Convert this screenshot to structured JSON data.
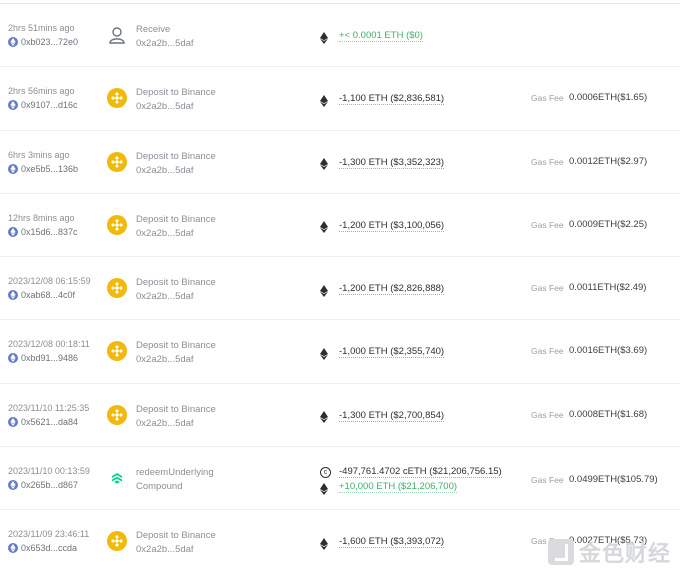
{
  "colors": {
    "bnb": "#f0b90b",
    "eth_badge": "#6478cc",
    "positive": "#3fae6c",
    "compound": "#00d395"
  },
  "gas_label": "Gas Fee",
  "watermark": "金色财经",
  "transactions": [
    {
      "time": "2hrs 51mins ago",
      "hash": "0xb023...72e0",
      "action": "Receive",
      "action_icon": "user-icon",
      "address": "0x2a2b...5daf",
      "amounts": [
        {
          "icon": "eth-icon",
          "text": "+< 0.0001 ETH ($0)",
          "positive": true
        }
      ],
      "gas": ""
    },
    {
      "time": "2hrs 56mins ago",
      "hash": "0x9107...d16c",
      "action": "Deposit to Binance",
      "action_icon": "binance-icon",
      "address": "0x2a2b...5daf",
      "amounts": [
        {
          "icon": "eth-icon",
          "text": "-1,100 ETH ($2,836,581)",
          "positive": false
        }
      ],
      "gas": "0.0006ETH($1.65)"
    },
    {
      "time": "6hrs 3mins ago",
      "hash": "0xe5b5...136b",
      "action": "Deposit to Binance",
      "action_icon": "binance-icon",
      "address": "0x2a2b...5daf",
      "amounts": [
        {
          "icon": "eth-icon",
          "text": "-1,300 ETH ($3,352,323)",
          "positive": false
        }
      ],
      "gas": "0.0012ETH($2.97)"
    },
    {
      "time": "12hrs 8mins ago",
      "hash": "0x15d6...837c",
      "action": "Deposit to Binance",
      "action_icon": "binance-icon",
      "address": "0x2a2b...5daf",
      "amounts": [
        {
          "icon": "eth-icon",
          "text": "-1,200 ETH ($3,100,056)",
          "positive": false
        }
      ],
      "gas": "0.0009ETH($2.25)"
    },
    {
      "time": "2023/12/08 06:15:59",
      "hash": "0xab68...4c0f",
      "action": "Deposit to Binance",
      "action_icon": "binance-icon",
      "address": "0x2a2b...5daf",
      "amounts": [
        {
          "icon": "eth-icon",
          "text": "-1,200 ETH ($2,826,888)",
          "positive": false
        }
      ],
      "gas": "0.0011ETH($2.49)"
    },
    {
      "time": "2023/12/08 00:18:11",
      "hash": "0xbd91...9486",
      "action": "Deposit to Binance",
      "action_icon": "binance-icon",
      "address": "0x2a2b...5daf",
      "amounts": [
        {
          "icon": "eth-icon",
          "text": "-1,000 ETH ($2,355,740)",
          "positive": false
        }
      ],
      "gas": "0.0016ETH($3.69)"
    },
    {
      "time": "2023/11/10 11:25:35",
      "hash": "0x5621...da84",
      "action": "Deposit to Binance",
      "action_icon": "binance-icon",
      "address": "0x2a2b...5daf",
      "amounts": [
        {
          "icon": "eth-icon",
          "text": "-1,300 ETH ($2,700,854)",
          "positive": false
        }
      ],
      "gas": "0.0008ETH($1.68)"
    },
    {
      "time": "2023/11/10 00:13:59",
      "hash": "0x265b...d867",
      "action": "redeemUnderlying",
      "action_icon": "compound-icon",
      "address": "Compound",
      "amounts": [
        {
          "icon": "ceth-icon",
          "text": "-497,761.4702 cETH ($21,206,756.15)",
          "positive": false
        },
        {
          "icon": "eth-icon",
          "text": "+10,000 ETH ($21,206,700)",
          "positive": true
        }
      ],
      "gas": "0.0499ETH($105.79)"
    },
    {
      "time": "2023/11/09 23:46:11",
      "hash": "0x653d...ccda",
      "action": "Deposit to Binance",
      "action_icon": "binance-icon",
      "address": "0x2a2b...5daf",
      "amounts": [
        {
          "icon": "eth-icon",
          "text": "-1,600 ETH ($3,393,072)",
          "positive": false
        }
      ],
      "gas": "0.0027ETH($5.73)"
    }
  ]
}
